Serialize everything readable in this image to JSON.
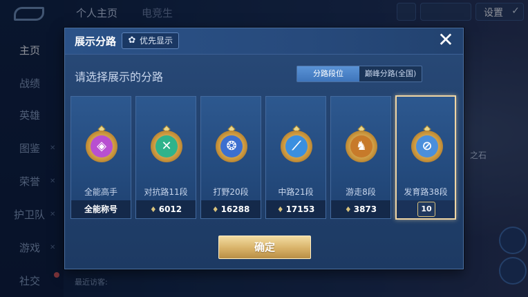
{
  "background": {
    "top_tabs": [
      "个人主页",
      "电竞生"
    ],
    "settings_label": "设置",
    "sidebar_items": [
      "主页",
      "战绩",
      "英雄",
      "图鉴",
      "荣誉",
      "护卫队",
      "游戏",
      "社交"
    ],
    "right_label": "之石",
    "bottom_hint": "最近访客:"
  },
  "dialog": {
    "title": "展示分路",
    "priority_label": "优先显示",
    "subtitle": "请选择展示的分路",
    "toggle": [
      "分路段位",
      "巅峰分路(全国)"
    ],
    "confirm_label": "确定",
    "cards": [
      {
        "name": "全能高手",
        "value": "全能称号",
        "core_color": "#b84fd1",
        "core_glyph": "◈"
      },
      {
        "name": "对抗路11段",
        "value": "6012",
        "core_color": "#2fb38b",
        "core_glyph": "✕"
      },
      {
        "name": "打野20段",
        "value": "16288",
        "core_color": "#3c6fd0",
        "core_glyph": "❂"
      },
      {
        "name": "中路21段",
        "value": "17153",
        "core_color": "#3a8fe0",
        "core_glyph": "⟋"
      },
      {
        "name": "游走8段",
        "value": "3873",
        "core_color": "#c77a2a",
        "core_glyph": "♞"
      },
      {
        "name": "发育路38段",
        "value": "",
        "core_color": "#4a8fdc",
        "core_glyph": "⊘",
        "rank_tag": "10"
      }
    ]
  }
}
